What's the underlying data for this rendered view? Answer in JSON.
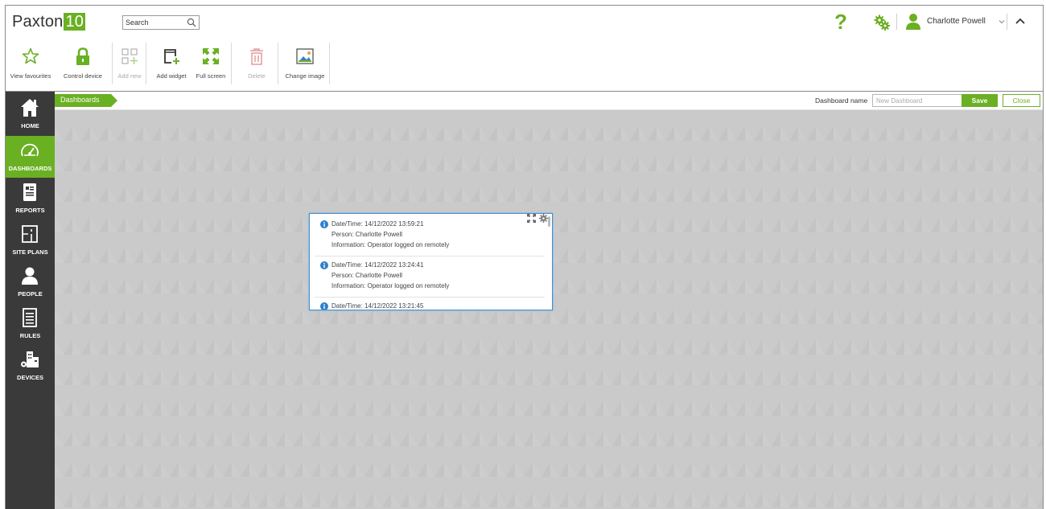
{
  "app": {
    "logo_text": "Paxton",
    "logo_number": "10",
    "search_placeholder": "Search",
    "user_name": "Charlotte Powell",
    "help_label": "?"
  },
  "toolbar": {
    "buttons": [
      {
        "label": "View favourites",
        "icon": "star-icon",
        "enabled": true
      },
      {
        "label": "Control device",
        "icon": "padlock-icon",
        "enabled": true
      },
      {
        "label": "Add new",
        "icon": "add-grid-icon",
        "enabled": false
      },
      {
        "label": "Add widget",
        "icon": "add-widget-icon",
        "enabled": true
      },
      {
        "label": "Full screen",
        "icon": "fullscreen-icon",
        "enabled": true
      },
      {
        "label": "Delete",
        "icon": "trash-icon",
        "enabled": false
      },
      {
        "label": "Change image",
        "icon": "image-icon",
        "enabled": true
      }
    ]
  },
  "sidebar": {
    "items": [
      {
        "label": "HOME",
        "icon": "home-icon",
        "active": false
      },
      {
        "label": "DASHBOARDS",
        "icon": "dashboard-gauge-icon",
        "active": true
      },
      {
        "label": "REPORTS",
        "icon": "reports-icon",
        "active": false
      },
      {
        "label": "SITE PLANS",
        "icon": "site-plan-icon",
        "active": false
      },
      {
        "label": "PEOPLE",
        "icon": "person-icon",
        "active": false
      },
      {
        "label": "RULES",
        "icon": "rules-icon",
        "active": false
      },
      {
        "label": "DEVICES",
        "icon": "devices-icon",
        "active": false
      }
    ]
  },
  "breadcrumb": {
    "items": [
      "Dashboards"
    ]
  },
  "dashboard_form": {
    "name_label": "Dashboard name",
    "name_placeholder": "New Dashboard",
    "name_value": "",
    "save_label": "Save",
    "close_label": "Close"
  },
  "widget": {
    "events": [
      {
        "datetime": "Date/Time: 14/12/2022 13:59:21",
        "person": "Person: Charlotte Powell",
        "information": "Information: Operator logged on remotely"
      },
      {
        "datetime": "Date/Time: 14/12/2022 13:24:41",
        "person": "Person: Charlotte Powell",
        "information": "Information: Operator logged on remotely"
      },
      {
        "datetime": "Date/Time: 14/12/2022 13:21:45",
        "person": "",
        "information": ""
      }
    ]
  },
  "colors": {
    "accent": "#6ab023",
    "sidebar_bg": "#3a3a3a",
    "canvas_bg": "#cacaca",
    "widget_border": "#3f8fd6",
    "info_blue": "#2f80c9"
  }
}
